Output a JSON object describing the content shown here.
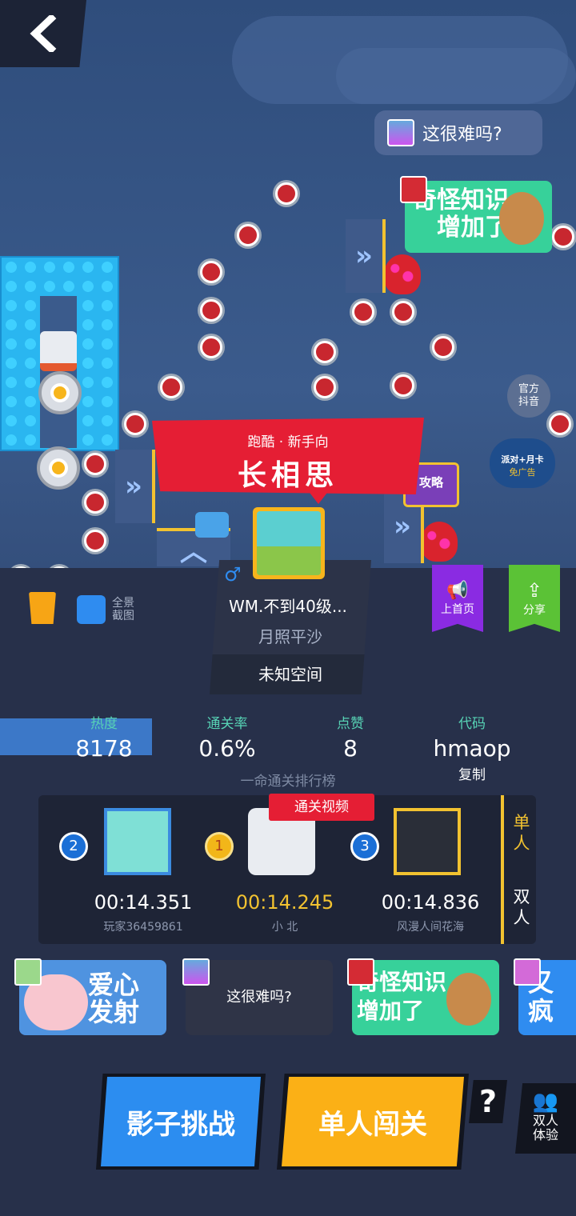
{
  "bubbles": {
    "top_comment": "这很难吗?",
    "sticker_1_lines": [
      "奇怪知识",
      "增加了"
    ]
  },
  "level": {
    "category": "跑酷 · 新手向",
    "title": "长相思",
    "author": "WM.不到40级...",
    "subtitle": "月照平沙",
    "space": "未知空间",
    "gender_symbol": "♂",
    "strategy_label": "攻略"
  },
  "side": {
    "official_label": "官方\n抖音",
    "promo_label": "派对+月卡",
    "promo_sub": "免广告",
    "homepage_label": "上首页",
    "share_label": "分享",
    "screenshot_label": "全景\n截图"
  },
  "stats": [
    {
      "key": "热度",
      "value": "8178"
    },
    {
      "key": "通关率",
      "value": "0.6%"
    },
    {
      "key": "点赞",
      "value": "8"
    },
    {
      "key": "代码",
      "value": "hmaop",
      "extra": "复制"
    }
  ],
  "leaderboard": {
    "title": "一命通关排行榜",
    "video_tag": "通关视频",
    "players": [
      {
        "rank": "2",
        "time": "00:14.351",
        "name": "玩家36459861"
      },
      {
        "rank": "1",
        "time": "00:14.245",
        "name": "小 北"
      },
      {
        "rank": "3",
        "time": "00:14.836",
        "name": "风漫人间花海"
      }
    ],
    "modes": [
      "单\n人",
      "双\n人"
    ]
  },
  "comments": [
    {
      "text": "爱心\n发射"
    },
    {
      "text": "这很难吗?"
    },
    {
      "text": "奇怪知识\n增加了"
    },
    {
      "text": "又疯\n一"
    }
  ],
  "buttons": {
    "shadow": "影子挑战",
    "single": "单人闯关",
    "help": "?",
    "duo": "双人\n体验"
  },
  "colors": {
    "banner_red": "#e51e34",
    "shadow_blue": "#2c8df0",
    "single_yellow": "#fbb016",
    "accent_green": "#57d3b5",
    "gold": "#f2c230"
  }
}
